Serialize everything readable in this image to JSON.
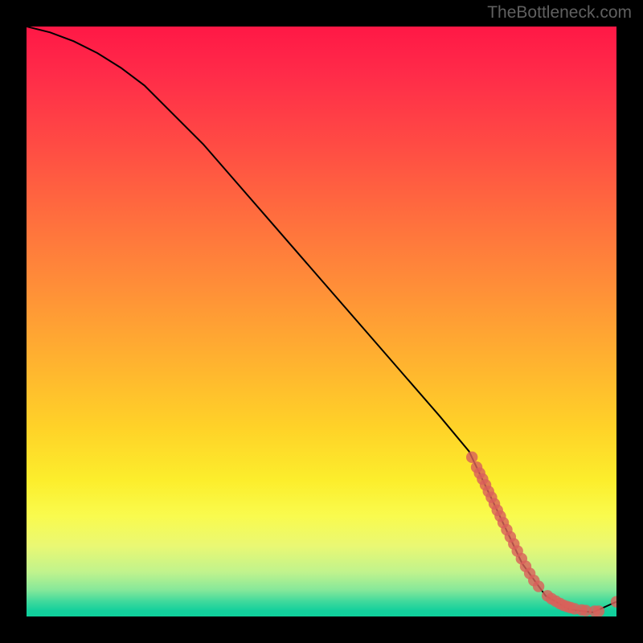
{
  "watermark": "TheBottleneck.com",
  "chart_data": {
    "type": "line",
    "title": "",
    "xlabel": "",
    "ylabel": "",
    "xlim": [
      0,
      100
    ],
    "ylim": [
      0,
      100
    ],
    "curve": {
      "x": [
        0,
        4,
        8,
        12,
        16,
        20,
        30,
        40,
        50,
        60,
        70,
        75,
        80,
        84,
        88,
        92,
        96,
        100
      ],
      "y": [
        100,
        99,
        97.5,
        95.5,
        93,
        90,
        80,
        68.5,
        57,
        45.5,
        34,
        28,
        17.5,
        9,
        3.5,
        1.2,
        0.7,
        2.5
      ]
    },
    "markers": {
      "x": [
        75.5,
        76.3,
        76.8,
        77.3,
        77.8,
        78.3,
        78.8,
        79.3,
        79.8,
        80.3,
        80.8,
        81.4,
        82.0,
        82.6,
        83.2,
        83.9,
        84.6,
        85.3,
        86.0,
        86.8,
        88.3,
        89.0,
        89.7,
        90.4,
        91.0,
        91.6,
        92.2,
        92.9,
        94.1,
        94.8,
        96.3,
        97.0,
        100.0
      ],
      "y": [
        27.0,
        25.3,
        24.3,
        23.3,
        22.3,
        21.2,
        20.2,
        19.1,
        18.0,
        17.0,
        15.9,
        14.7,
        13.5,
        12.3,
        11.1,
        9.8,
        8.5,
        7.3,
        6.1,
        5.1,
        3.5,
        3.0,
        2.6,
        2.2,
        1.9,
        1.7,
        1.5,
        1.3,
        1.1,
        1.0,
        0.9,
        0.9,
        2.5
      ]
    }
  }
}
